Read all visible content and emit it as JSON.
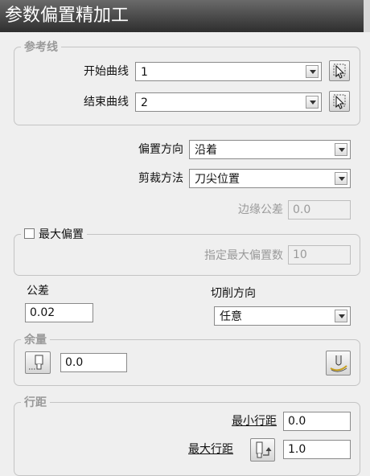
{
  "title": "参数偏置精加工",
  "reference_lines": {
    "group_label": "参考线",
    "start_curve": {
      "label": "开始曲线",
      "value": "1"
    },
    "end_curve": {
      "label": "结束曲线",
      "value": "2"
    }
  },
  "offset_direction": {
    "label": "偏置方向",
    "value": "沿着"
  },
  "trim_method": {
    "label": "剪裁方法",
    "value": "刀尖位置"
  },
  "edge_tolerance": {
    "label": "边缘公差",
    "value": "0.0"
  },
  "max_offset": {
    "checkbox_label": "最大偏置",
    "checked": false,
    "count_label": "指定最大偏置数",
    "count_value": "10"
  },
  "tolerance": {
    "label": "公差",
    "value": "0.02"
  },
  "cut_direction": {
    "label": "切削方向",
    "value": "任意"
  },
  "thickness": {
    "group_label": "余量",
    "value": "0.0"
  },
  "stepover": {
    "group_label": "行距",
    "min_label": "最小行距",
    "min_value": "0.0",
    "max_label": "最大行距",
    "max_value": "1.0"
  },
  "icons": {
    "pick": "pointer-select-icon",
    "thickness_tool": "tool-thickness-icon",
    "component_thickness": "component-thickness-icon",
    "stepover_link": "stepover-link-icon"
  }
}
